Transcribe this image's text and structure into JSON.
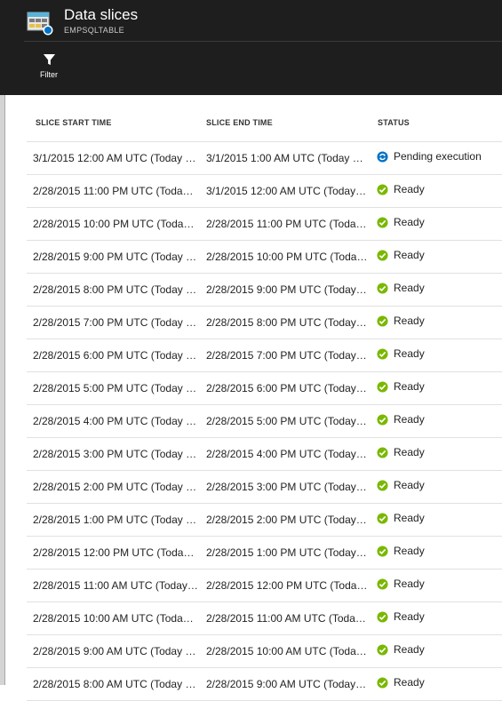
{
  "header": {
    "title": "Data slices",
    "subtitle": "EMPSQLTABLE",
    "filter_label": "Filter"
  },
  "columns": {
    "start": "SLICE START TIME",
    "end": "SLICE END TIME",
    "status": "STATUS"
  },
  "colors": {
    "header_bg": "#1e1e1e",
    "ready": "#7ab800",
    "pending": "#0072c6"
  },
  "rows": [
    {
      "start": "3/1/2015 12:00 AM UTC (Today 7…",
      "end": "3/1/2015 1:00 AM UTC (Today 8:…",
      "status": "Pending execution",
      "status_icon": "pending-refresh-icon"
    },
    {
      "start": "2/28/2015 11:00 PM UTC (Today…",
      "end": "3/1/2015 12:00 AM UTC (Today…",
      "status": "Ready",
      "status_icon": "ready-check-icon"
    },
    {
      "start": "2/28/2015 10:00 PM UTC (Today…",
      "end": "2/28/2015 11:00 PM UTC (Today…",
      "status": "Ready",
      "status_icon": "ready-check-icon"
    },
    {
      "start": "2/28/2015 9:00 PM UTC (Today 4…",
      "end": "2/28/2015 10:00 PM UTC (Today…",
      "status": "Ready",
      "status_icon": "ready-check-icon"
    },
    {
      "start": "2/28/2015 8:00 PM UTC (Today 3…",
      "end": "2/28/2015 9:00 PM UTC (Today…",
      "status": "Ready",
      "status_icon": "ready-check-icon"
    },
    {
      "start": "2/28/2015 7:00 PM UTC (Today 2…",
      "end": "2/28/2015 8:00 PM UTC (Today…",
      "status": "Ready",
      "status_icon": "ready-check-icon"
    },
    {
      "start": "2/28/2015 6:00 PM UTC (Today 1…",
      "end": "2/28/2015 7:00 PM UTC (Today…",
      "status": "Ready",
      "status_icon": "ready-check-icon"
    },
    {
      "start": "2/28/2015 5:00 PM UTC (Today 1…",
      "end": "2/28/2015 6:00 PM UTC (Today…",
      "status": "Ready",
      "status_icon": "ready-check-icon"
    },
    {
      "start": "2/28/2015 4:00 PM UTC (Today 1…",
      "end": "2/28/2015 5:00 PM UTC (Today…",
      "status": "Ready",
      "status_icon": "ready-check-icon"
    },
    {
      "start": "2/28/2015 3:00 PM UTC (Today 1…",
      "end": "2/28/2015 4:00 PM UTC (Today…",
      "status": "Ready",
      "status_icon": "ready-check-icon"
    },
    {
      "start": "2/28/2015 2:00 PM UTC (Today 9…",
      "end": "2/28/2015 3:00 PM UTC (Today…",
      "status": "Ready",
      "status_icon": "ready-check-icon"
    },
    {
      "start": "2/28/2015 1:00 PM UTC (Today 8…",
      "end": "2/28/2015 2:00 PM UTC (Today…",
      "status": "Ready",
      "status_icon": "ready-check-icon"
    },
    {
      "start": "2/28/2015 12:00 PM UTC (Today…",
      "end": "2/28/2015 1:00 PM UTC (Today…",
      "status": "Ready",
      "status_icon": "ready-check-icon"
    },
    {
      "start": "2/28/2015 11:00 AM UTC (Today…",
      "end": "2/28/2015 12:00 PM UTC (Today…",
      "status": "Ready",
      "status_icon": "ready-check-icon"
    },
    {
      "start": "2/28/2015 10:00 AM UTC (Today…",
      "end": "2/28/2015 11:00 AM UTC (Today…",
      "status": "Ready",
      "status_icon": "ready-check-icon"
    },
    {
      "start": "2/28/2015 9:00 AM UTC (Today 4…",
      "end": "2/28/2015 10:00 AM UTC (Today…",
      "status": "Ready",
      "status_icon": "ready-check-icon"
    },
    {
      "start": "2/28/2015 8:00 AM UTC (Today 3…",
      "end": "2/28/2015 9:00 AM UTC (Today…",
      "status": "Ready",
      "status_icon": "ready-check-icon"
    }
  ]
}
